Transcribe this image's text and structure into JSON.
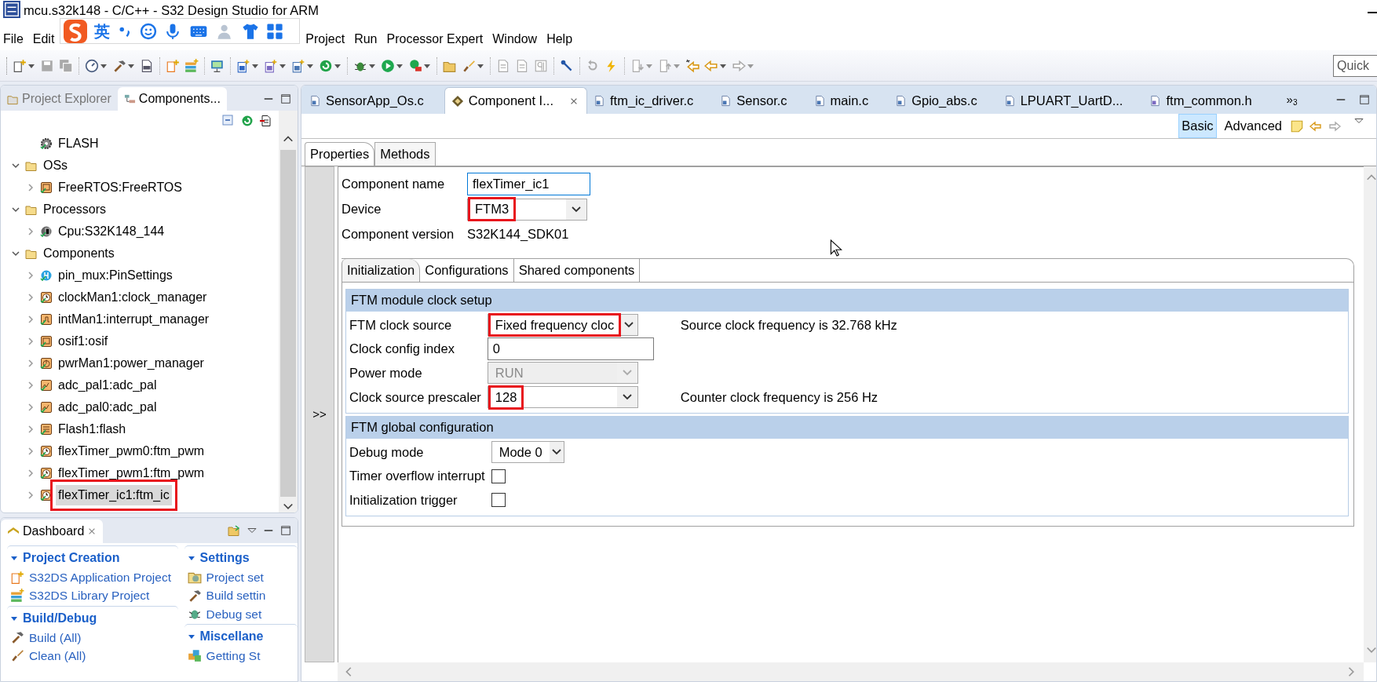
{
  "window": {
    "title": "mcu.s32k148 - C/C++ - S32 Design Studio for ARM"
  },
  "ime_toolbar": {
    "language": "英"
  },
  "menu": {
    "before_overlay": [
      "File",
      "Edit"
    ],
    "after_overlay": [
      "Project",
      "Run",
      "Processor Expert",
      "Window",
      "Help"
    ]
  },
  "toolbar": {
    "groups": [
      [
        {
          "kind": "new",
          "dropdown": true,
          "disabled": false
        },
        {
          "kind": "save",
          "dropdown": false,
          "disabled": true
        },
        {
          "kind": "save-all",
          "dropdown": false,
          "disabled": true
        }
      ],
      [
        {
          "kind": "gauge",
          "dropdown": true,
          "disabled": false
        },
        {
          "kind": "hammer",
          "dropdown": true,
          "disabled": false
        },
        {
          "kind": "binary",
          "dropdown": false,
          "disabled": false
        }
      ],
      [
        {
          "kind": "new-project",
          "dropdown": false,
          "disabled": false
        },
        {
          "kind": "library",
          "dropdown": false,
          "disabled": false
        }
      ],
      [
        {
          "kind": "monitor",
          "dropdown": false,
          "disabled": false
        }
      ],
      [
        {
          "kind": "class",
          "dropdown": true,
          "disabled": false
        },
        {
          "kind": "header",
          "dropdown": true,
          "disabled": false
        },
        {
          "kind": "source",
          "dropdown": true,
          "disabled": false
        },
        {
          "kind": "refresh",
          "dropdown": true,
          "disabled": false
        }
      ],
      [
        {
          "kind": "bug",
          "dropdown": true,
          "disabled": false
        },
        {
          "kind": "run",
          "dropdown": true,
          "disabled": false
        },
        {
          "kind": "tool",
          "dropdown": true,
          "disabled": false
        }
      ],
      [
        {
          "kind": "folder",
          "dropdown": false,
          "disabled": false
        },
        {
          "kind": "brush",
          "dropdown": true,
          "disabled": false
        }
      ],
      [
        {
          "kind": "doc",
          "dropdown": false,
          "disabled": true
        },
        {
          "kind": "doc",
          "dropdown": false,
          "disabled": true
        },
        {
          "kind": "pilcrow",
          "dropdown": false,
          "disabled": true
        }
      ],
      [
        {
          "kind": "pin",
          "dropdown": false,
          "disabled": false
        }
      ],
      [
        {
          "kind": "reset",
          "dropdown": false,
          "disabled": true
        },
        {
          "kind": "bolt",
          "dropdown": false,
          "disabled": false
        }
      ],
      [
        {
          "kind": "down",
          "dropdown": true,
          "disabled": true
        },
        {
          "kind": "up",
          "dropdown": true,
          "disabled": true
        },
        {
          "kind": "last-edit",
          "dropdown": false,
          "disabled": false
        },
        {
          "kind": "back",
          "dropdown": true,
          "disabled": false
        },
        {
          "kind": "forward",
          "dropdown": true,
          "disabled": true
        }
      ]
    ],
    "quick_access": {
      "placeholder": "Quick"
    }
  },
  "left_panel": {
    "tabs": [
      {
        "label": "Project Explorer",
        "selected": false
      },
      {
        "label": "Components...",
        "selected": true
      }
    ],
    "tree": {
      "continued_children": [
        {
          "label": "FLASH",
          "kind": "gear"
        }
      ],
      "items": [
        {
          "label": "OSs",
          "kind": "folder",
          "expanded": true,
          "highlighted": false,
          "children": [
            {
              "label": "FreeRTOS:FreeRTOS",
              "kind": "os",
              "expanded": false,
              "highlighted": false
            }
          ]
        },
        {
          "label": "Processors",
          "kind": "folder",
          "expanded": true,
          "highlighted": false,
          "children": [
            {
              "label": "Cpu:S32K148_144",
              "kind": "cpu",
              "expanded": false,
              "highlighted": false
            }
          ]
        },
        {
          "label": "Components",
          "kind": "folder",
          "expanded": true,
          "highlighted": false,
          "children": [
            {
              "label": "pin_mux:PinSettings",
              "kind": "pins",
              "expanded": false,
              "highlighted": false
            },
            {
              "label": "clockMan1:clock_manager",
              "kind": "clock",
              "expanded": false,
              "highlighted": false
            },
            {
              "label": "intMan1:interrupt_manager",
              "kind": "interrupt",
              "expanded": false,
              "highlighted": false
            },
            {
              "label": "osif1:osif",
              "kind": "os",
              "expanded": false,
              "highlighted": false
            },
            {
              "label": "pwrMan1:power_manager",
              "kind": "power",
              "expanded": false,
              "highlighted": false
            },
            {
              "label": "adc_pal1:adc_pal",
              "kind": "adc",
              "expanded": false,
              "highlighted": false
            },
            {
              "label": "adc_pal0:adc_pal",
              "kind": "adc",
              "expanded": false,
              "highlighted": false
            },
            {
              "label": "Flash1:flash",
              "kind": "flash",
              "expanded": false,
              "highlighted": false
            },
            {
              "label": "flexTimer_pwm0:ftm_pwm",
              "kind": "clock",
              "expanded": false,
              "highlighted": false
            },
            {
              "label": "flexTimer_pwm1:ftm_pwm",
              "kind": "clock",
              "expanded": false,
              "highlighted": false
            },
            {
              "label": "flexTimer_ic1:ftm_ic",
              "kind": "clock",
              "expanded": false,
              "highlighted": true
            }
          ]
        }
      ]
    }
  },
  "dashboard": {
    "title": "Dashboard",
    "columns": [
      [
        {
          "title": "Project Creation",
          "expanded": true,
          "items": [
            {
              "label": "S32DS Application Project",
              "kind": "new-project"
            },
            {
              "label": "S32DS Library Project",
              "kind": "library"
            }
          ]
        },
        {
          "title": "Build/Debug",
          "expanded": true,
          "items": [
            {
              "label": "Build  (All)",
              "kind": "hammer"
            },
            {
              "label": "Clean  (All)",
              "kind": "brush"
            }
          ]
        }
      ],
      [
        {
          "title": "Settings",
          "expanded": true,
          "items": [
            {
              "label": "Project set",
              "kind": "settings"
            },
            {
              "label": "Build settin",
              "kind": "hammer"
            },
            {
              "label": "Debug set",
              "kind": "bug"
            }
          ]
        },
        {
          "title": "Miscellane",
          "expanded": true,
          "items": [
            {
              "label": "Getting St",
              "kind": "cubes"
            }
          ]
        }
      ]
    ]
  },
  "editor": {
    "tabs": [
      {
        "label": "SensorApp_Os.c",
        "kind": "c",
        "selected": false
      },
      {
        "label": "Component I...",
        "kind": "component",
        "selected": true
      },
      {
        "label": "ftm_ic_driver.c",
        "kind": "c",
        "selected": false
      },
      {
        "label": "Sensor.c",
        "kind": "c",
        "selected": false
      },
      {
        "label": "main.c",
        "kind": "c",
        "selected": false
      },
      {
        "label": "Gpio_abs.c",
        "kind": "c",
        "selected": false
      },
      {
        "label": "LPUART_UartD...",
        "kind": "c",
        "selected": false
      },
      {
        "label": "ftm_common.h",
        "kind": "h",
        "selected": false
      }
    ],
    "overflow": "»",
    "overflow_count": "3",
    "modes": [
      {
        "label": "Basic",
        "selected": true
      },
      {
        "label": "Advanced",
        "selected": false
      }
    ],
    "page_tabs": [
      {
        "label": "Properties",
        "selected": true
      },
      {
        "label": "Methods",
        "selected": false
      }
    ],
    "side_toggle": ">>",
    "fields": [
      {
        "label": "Component name",
        "kind": "text",
        "value": "flexTimer_ic1",
        "focused": true,
        "highlighted": false
      },
      {
        "label": "Device",
        "kind": "select",
        "value": "FTM3",
        "highlighted": true
      },
      {
        "label": "Component version",
        "kind": "plain",
        "value": "S32K144_SDK01"
      }
    ],
    "inner_tabs": [
      {
        "label": "Initialization",
        "selected": true
      },
      {
        "label": "Configurations",
        "selected": false
      },
      {
        "label": "Shared components",
        "selected": false
      }
    ],
    "groups": [
      {
        "title": "FTM module clock setup",
        "rows": [
          {
            "label": "FTM clock source",
            "kind": "select",
            "value": "Fixed frequency cloc",
            "disabled": false,
            "highlighted": true,
            "note": "Source clock frequency is 32.768 kHz"
          },
          {
            "label": "Clock config index",
            "kind": "text",
            "value": "0"
          },
          {
            "label": "Power mode",
            "kind": "select",
            "value": "RUN",
            "disabled": true,
            "highlighted": false
          },
          {
            "label": "Clock source prescaler",
            "kind": "select",
            "value": "128",
            "disabled": false,
            "highlighted": true,
            "note": "Counter clock frequency is 256 Hz"
          }
        ]
      },
      {
        "title": "FTM global configuration",
        "rows": [
          {
            "label": "Debug mode",
            "kind": "select",
            "value": "Mode 0",
            "disabled": false,
            "highlighted": false,
            "compact": true
          },
          {
            "label": "Timer overflow interrupt",
            "kind": "checkbox",
            "checked": false
          },
          {
            "label": "Initialization trigger",
            "kind": "checkbox",
            "checked": false
          }
        ]
      }
    ]
  }
}
